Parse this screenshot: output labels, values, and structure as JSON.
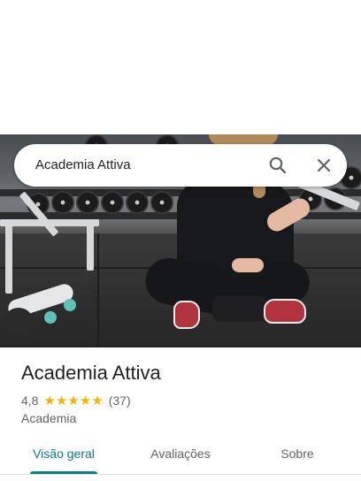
{
  "search": {
    "query": "Academia Attiva"
  },
  "icons": {
    "search": "search-icon",
    "close": "close-icon",
    "star": "star-icon"
  },
  "place": {
    "title": "Academia Attiva",
    "rating": "4,8",
    "stars": "★★★★★",
    "reviews_count": "(37)",
    "category": "Academia"
  },
  "tabs": [
    {
      "label": "Visão geral",
      "active": true
    },
    {
      "label": "Avaliações",
      "active": false
    },
    {
      "label": "Sobre",
      "active": false
    }
  ],
  "colors": {
    "accent": "#0b7e86",
    "star": "#f5b400",
    "text_primary": "#202124",
    "text_secondary": "#5f6368"
  }
}
